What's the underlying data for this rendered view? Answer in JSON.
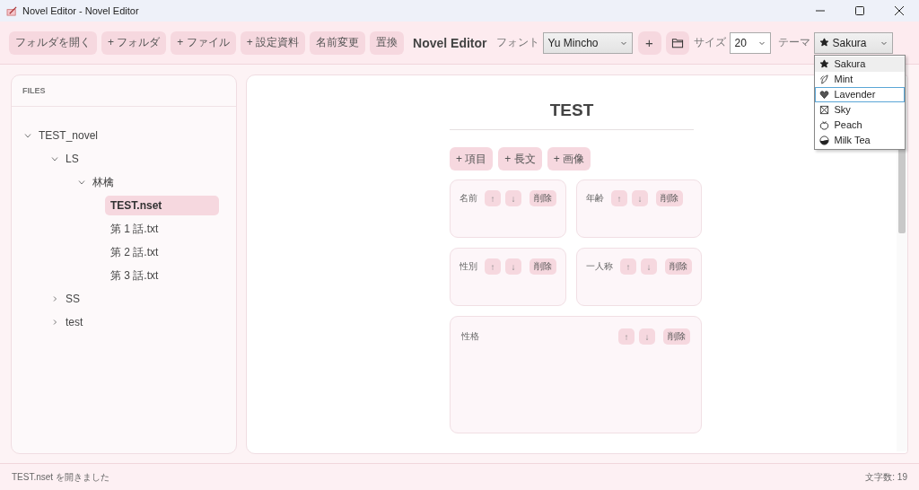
{
  "window": {
    "title": "Novel Editor - Novel Editor"
  },
  "toolbar": {
    "buttons": [
      "フォルダを開く",
      "+ フォルダ",
      "+ ファイル",
      "+ 設定資料",
      "名前変更",
      "置換"
    ],
    "app_title": "Novel Editor",
    "font_label": "フォント",
    "font_select": {
      "value": "Yu Mincho"
    },
    "add_button": "+",
    "size_label": "サイズ",
    "size_select": {
      "value": "20"
    },
    "theme_label": "テーマ",
    "theme_select": {
      "value": "Sakura",
      "expanded": true,
      "options": [
        {
          "label": "Sakura",
          "selected": true,
          "highlighted": false
        },
        {
          "label": "Mint",
          "selected": false,
          "highlighted": false
        },
        {
          "label": "Lavender",
          "selected": false,
          "highlighted": true
        },
        {
          "label": "Sky",
          "selected": false,
          "highlighted": false
        },
        {
          "label": "Peach",
          "selected": false,
          "highlighted": false
        },
        {
          "label": "Milk Tea",
          "selected": false,
          "highlighted": false
        }
      ]
    }
  },
  "sidebar": {
    "heading": "FILES",
    "tree": [
      {
        "label": "TEST_novel",
        "kind": "folder",
        "expanded": true,
        "children": [
          {
            "label": "LS",
            "kind": "folder",
            "expanded": true,
            "children": [
              {
                "label": "林檎",
                "kind": "folder",
                "expanded": true,
                "children": [
                  {
                    "label": "TEST.nset",
                    "kind": "file",
                    "selected": true
                  },
                  {
                    "label": "第 1 話.txt",
                    "kind": "file",
                    "selected": false
                  },
                  {
                    "label": "第 2 話.txt",
                    "kind": "file",
                    "selected": false
                  },
                  {
                    "label": "第 3 話.txt",
                    "kind": "file",
                    "selected": false
                  }
                ]
              }
            ]
          },
          {
            "label": "SS",
            "kind": "folder",
            "expanded": false
          },
          {
            "label": "test",
            "kind": "folder",
            "expanded": false
          }
        ]
      }
    ]
  },
  "editor": {
    "title": "TEST",
    "add_buttons": [
      "+ 項目",
      "+ 長文",
      "+ 画像"
    ],
    "fields": [
      {
        "label": "名前",
        "kind": "short",
        "buttons": [
          "↑",
          "↓",
          "削除"
        ]
      },
      {
        "label": "年齢",
        "kind": "short",
        "buttons": [
          "↑",
          "↓",
          "削除"
        ]
      },
      {
        "label": "性別",
        "kind": "short",
        "buttons": [
          "↑",
          "↓",
          "削除"
        ]
      },
      {
        "label": "一人称",
        "kind": "short",
        "buttons": [
          "↑",
          "↓",
          "削除"
        ]
      },
      {
        "label": "性格",
        "kind": "long",
        "buttons": [
          "↑",
          "↓",
          "削除"
        ]
      }
    ]
  },
  "status_bar": {
    "message": "TEST.nset を開きました",
    "char_count": "文字数: 19"
  }
}
